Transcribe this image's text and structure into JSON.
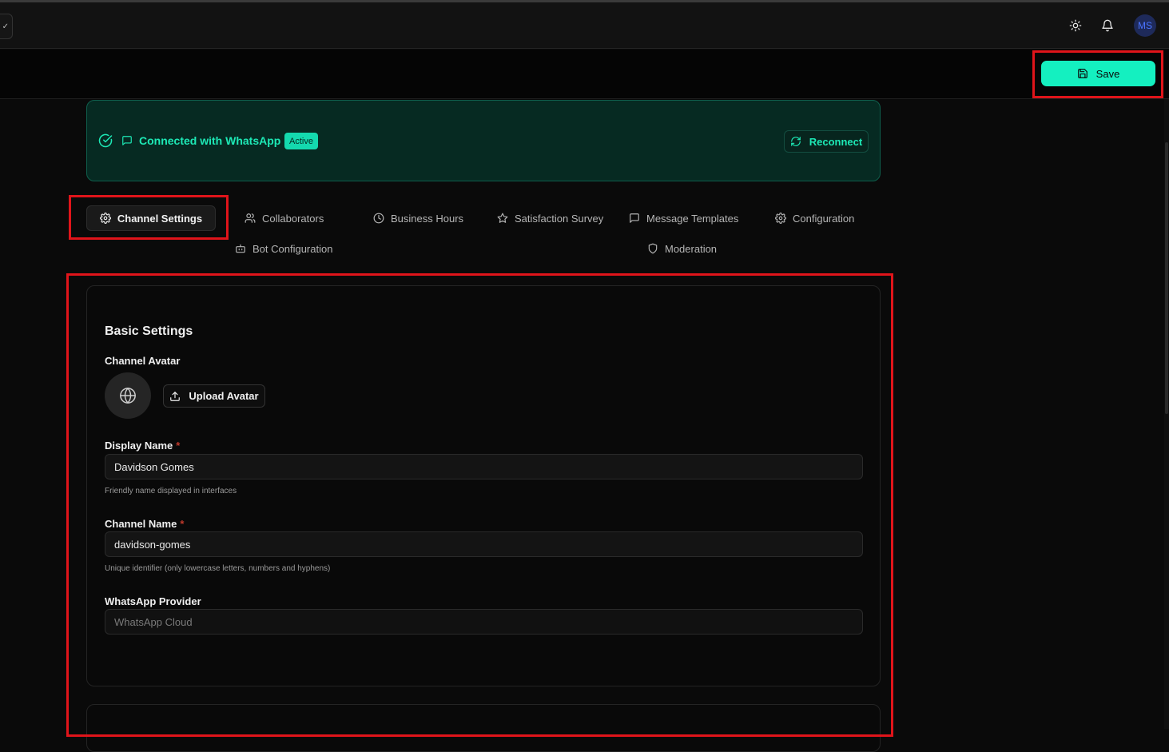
{
  "header": {
    "sidebar_toggle_glyph": "✓",
    "theme_icon": "sun-icon",
    "notifications_icon": "bell-icon",
    "user_initials": "MS"
  },
  "toolbar": {
    "save_label": "Save"
  },
  "connection": {
    "title": "Connected with WhatsApp",
    "status_badge": "Active",
    "reconnect_label": "Reconnect"
  },
  "tabs": [
    {
      "label": "Channel Settings",
      "icon": "gear-icon",
      "active": true
    },
    {
      "label": "Collaborators",
      "icon": "users-icon"
    },
    {
      "label": "Business Hours",
      "icon": "clock-icon"
    },
    {
      "label": "Satisfaction Survey",
      "icon": "star-icon"
    },
    {
      "label": "Message Templates",
      "icon": "message-icon"
    },
    {
      "label": "Configuration",
      "icon": "gear-icon"
    },
    {
      "label": "Bot Configuration",
      "icon": "bot-icon"
    },
    {
      "label": "Moderation",
      "icon": "shield-icon"
    }
  ],
  "basic_settings": {
    "title": "Basic Settings",
    "avatar_label": "Channel Avatar",
    "upload_label": "Upload Avatar",
    "display_name": {
      "label": "Display Name",
      "required_mark": "*",
      "value": "Davidson Gomes",
      "hint": "Friendly name displayed in interfaces"
    },
    "channel_name": {
      "label": "Channel Name",
      "required_mark": "*",
      "value": "davidson-gomes",
      "hint": "Unique identifier (only lowercase letters, numbers and hyphens)"
    },
    "provider": {
      "label": "WhatsApp Provider",
      "value": "WhatsApp Cloud"
    }
  },
  "colors": {
    "accent": "#14f0c0",
    "highlight": "#e0141a",
    "banner_bg": "#062a22"
  }
}
